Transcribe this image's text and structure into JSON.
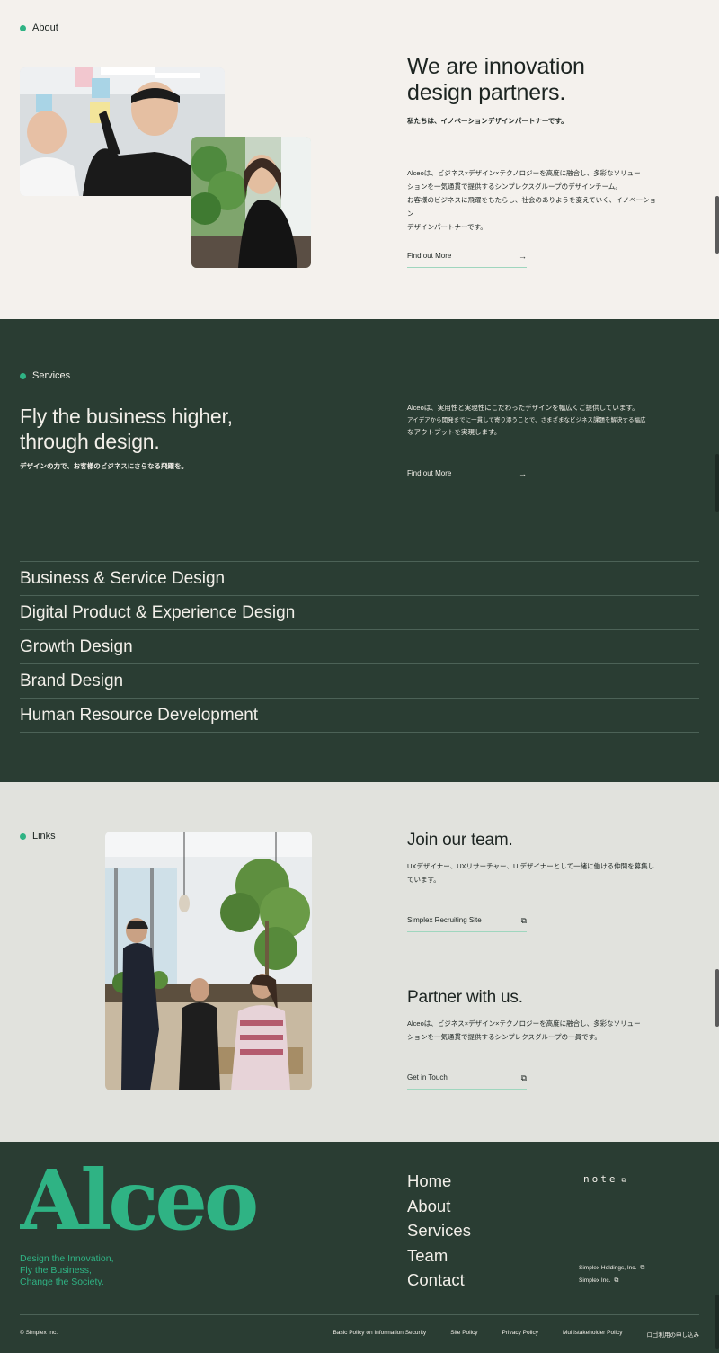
{
  "about": {
    "label": "About",
    "heading_line1": "We are innovation",
    "heading_line2": "design partners.",
    "subheading": "私たちは、イノベーションデザインパートナーです。",
    "body_line1": "Alceoは、ビジネス×デザイン×テクノロジーを高度に融合し、多彩なソリュー",
    "body_line2": "ションを一気通貫で提供するシンプレクスグループのデザインチーム。",
    "body_line3": "お客様のビジネスに飛躍をもたらし、社会のありようを変えていく、イノベーション",
    "body_line4": "デザインパートナーです。",
    "cta_label": "Find out More",
    "cta_icon": "arrow-right-icon"
  },
  "services": {
    "label": "Services",
    "heading_line1": "Fly the business higher,",
    "heading_line2": "through design.",
    "subheading": "デザインの力で、お客様のビジネスにさらなる飛躍を。",
    "body_line1": "Alceoは、実用性と実現性にこだわったデザインを幅広くご提供しています。",
    "body_line2": "アイデアから開発までに一貫して寄り添うことで、さまざまなビジネス課題を解決する幅広",
    "body_line3": "なアウトプットを実現します。",
    "cta_label": "Find out More",
    "items": [
      "Business & Service Design",
      "Digital Product & Experience Design",
      "Growth Design",
      "Brand Design",
      "Human Resource Development"
    ]
  },
  "links": {
    "label": "Links",
    "join_heading": "Join our team.",
    "join_body_line1": "UXデザイナー、UXリサーチャー、UIデザイナーとして一緒に働ける仲間を募集し",
    "join_body_line2": "ています。",
    "join_cta": "Simplex Recruiting Site",
    "partner_heading": "Partner with us.",
    "partner_body_line1": "Alceoは、ビジネス×デザイン×テクノロジーを高度に融合し、多彩なソリュー",
    "partner_body_line2": "ションを一気通貫で提供するシンプレクスグループの一員です。",
    "partner_cta": "Get in Touch"
  },
  "footer": {
    "logo_text": "Alceo",
    "tagline_line1": "Design the Innovation,",
    "tagline_line2": "Fly the Business,",
    "tagline_line3": "Change the Society.",
    "nav": [
      "Home",
      "About",
      "Services",
      "Team",
      "Contact"
    ],
    "note_label": "note",
    "companies": [
      "Simplex Holdings, Inc.",
      "Simplex Inc."
    ],
    "copyright": "© Simplex Inc.",
    "policies": [
      "Basic Policy on Information Security",
      "Site Policy",
      "Privacy Policy",
      "Multistakeholder Policy",
      "ロゴ利用の申し込み"
    ]
  },
  "colors": {
    "accent": "#2fb384",
    "dark_green": "#2a3d33",
    "cream": "#f4f1ed",
    "light_gray": "#e1e2dd"
  }
}
